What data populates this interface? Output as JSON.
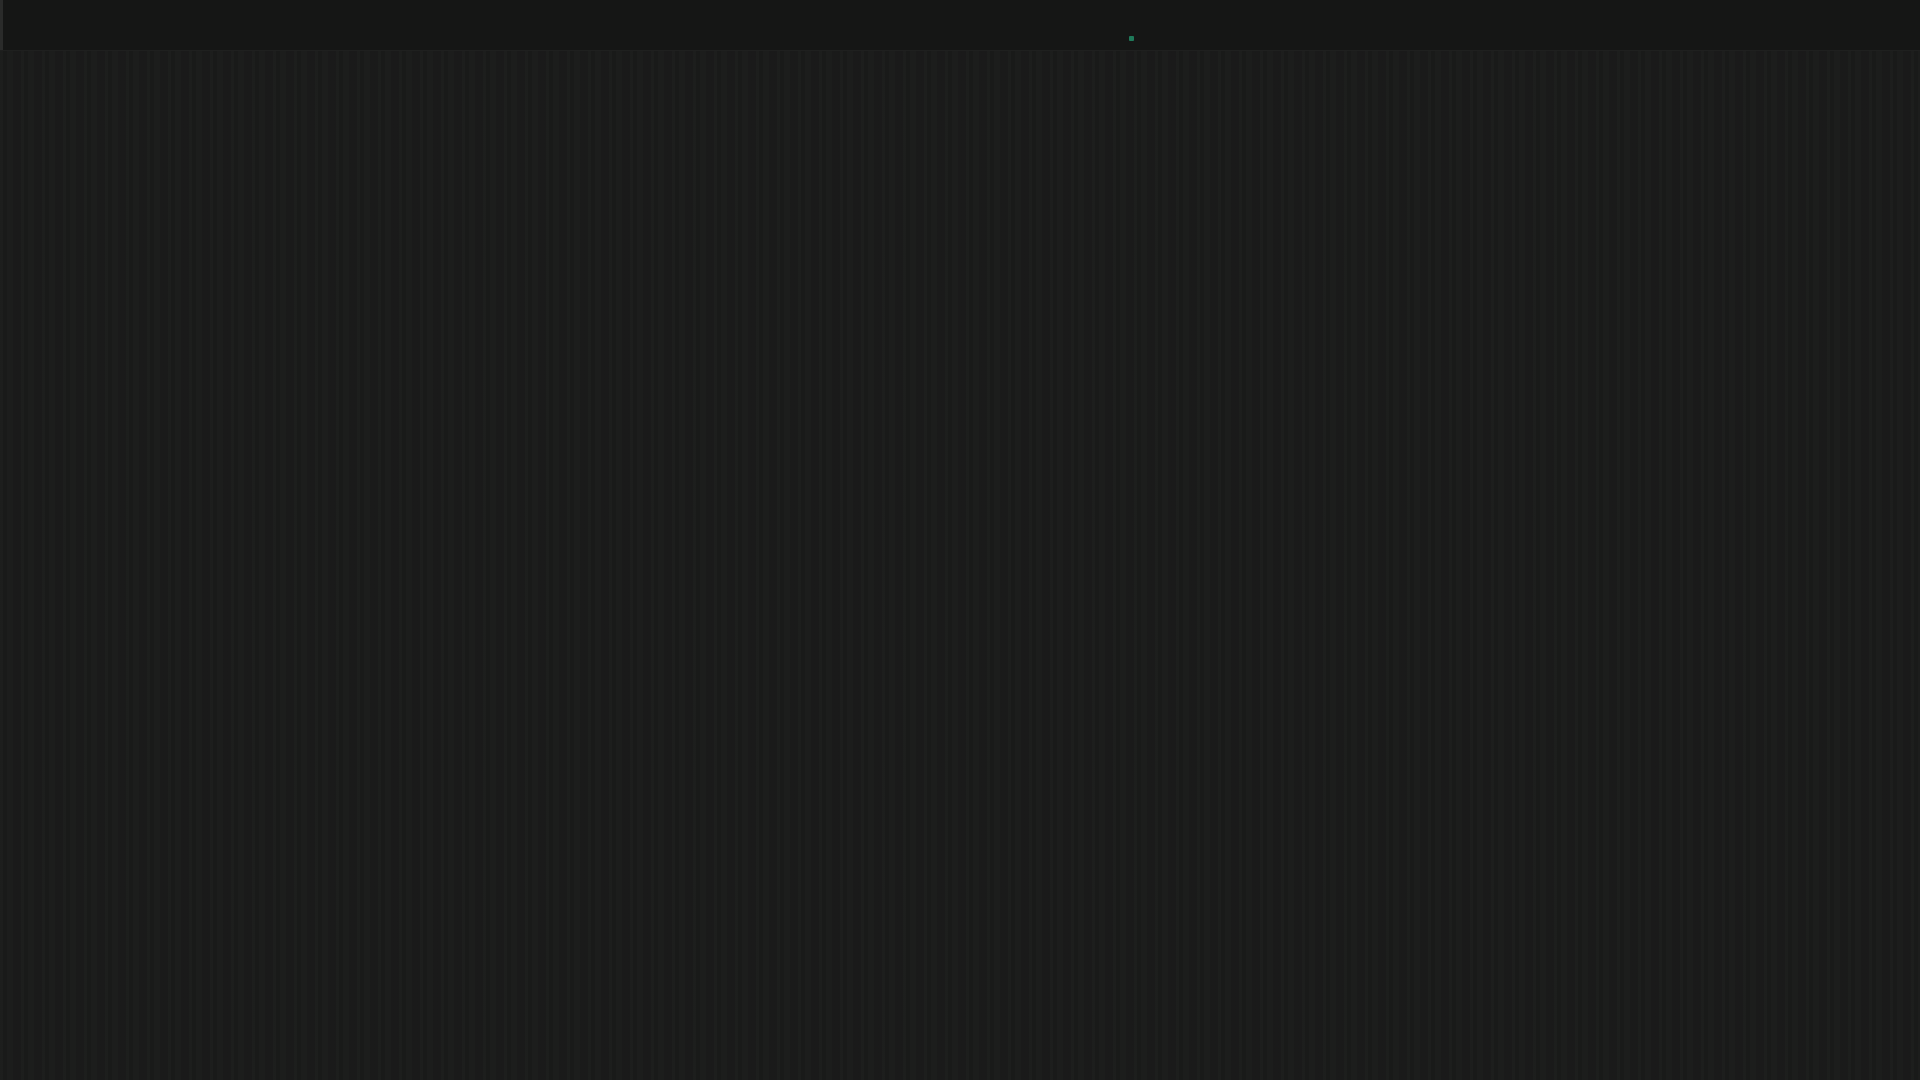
{
  "window": {
    "title": ""
  },
  "status": {
    "text": "",
    "accent_color": "#1f3a8a",
    "dot_color": "#1f7a5a"
  },
  "colors": {
    "background": "#1a1b1a",
    "top_bar": "#151615"
  }
}
